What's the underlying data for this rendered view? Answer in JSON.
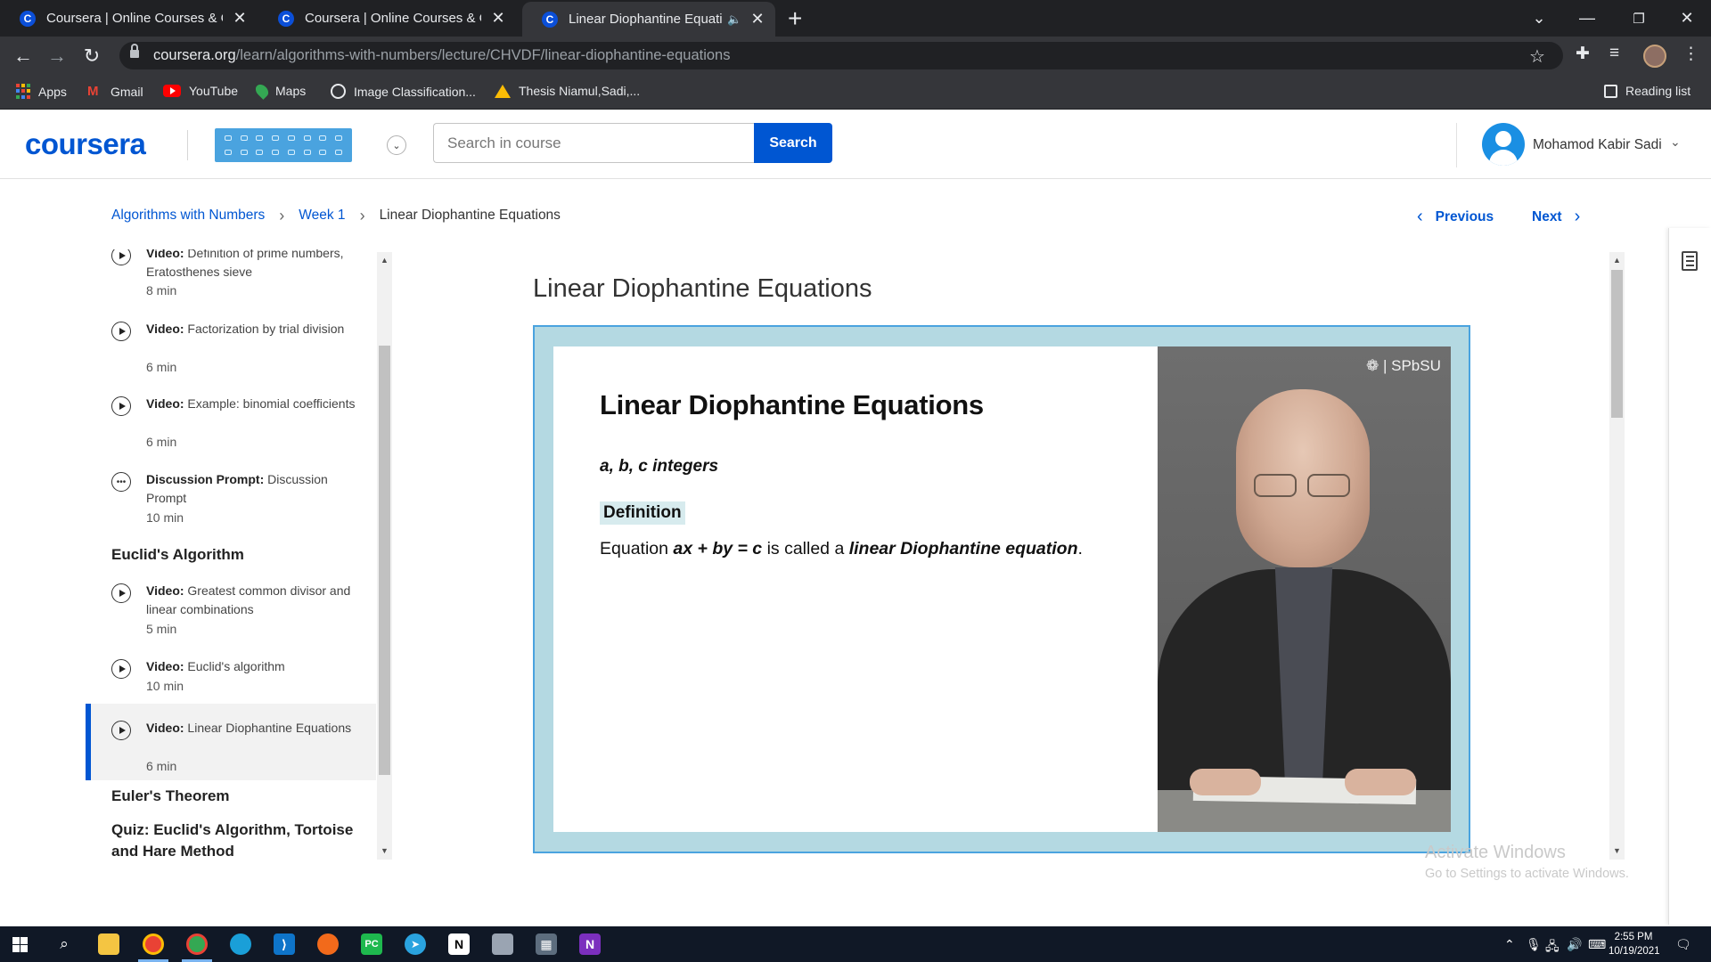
{
  "browser": {
    "tabs": [
      {
        "title": "Coursera | Online Courses & Credentials",
        "favicon": "C",
        "active": false
      },
      {
        "title": "Coursera | Online Courses & Credentials",
        "favicon": "C",
        "active": false
      },
      {
        "title": "Linear Diophantine Equations",
        "favicon": "C",
        "active": true,
        "audio": true
      }
    ],
    "url_host": "coursera.org",
    "url_path": "/learn/algorithms-with-numbers/lecture/CHVDF/linear-diophantine-equations",
    "bookmarks": [
      {
        "label": "Apps",
        "icon": "apps-grid-icon"
      },
      {
        "label": "Gmail",
        "icon": "gmail-icon"
      },
      {
        "label": "YouTube",
        "icon": "youtube-icon"
      },
      {
        "label": "Maps",
        "icon": "maps-pin-icon"
      },
      {
        "label": "Image Classification...",
        "icon": "globe-icon"
      },
      {
        "label": "Thesis Niamul,Sadi,...",
        "icon": "drive-icon"
      }
    ],
    "reading_list": "Reading list"
  },
  "header": {
    "logo": "coursera",
    "search_placeholder": "Search in course",
    "search_button": "Search",
    "user_name": "Mohamod Kabir Sadi"
  },
  "breadcrumb": {
    "course": "Algorithms with Numbers",
    "week": "Week 1",
    "current": "Linear Diophantine Equations"
  },
  "nav": {
    "previous": "Previous",
    "next": "Next"
  },
  "sidebar": {
    "items": [
      {
        "type": "Video:",
        "title": "Definition of prime numbers, Eratosthenes sieve",
        "duration": "8 min"
      },
      {
        "type": "Video:",
        "title": "Factorization by trial division",
        "duration": "6 min"
      },
      {
        "type": "Video:",
        "title": "Example: binomial coefficients",
        "duration": "6 min"
      },
      {
        "type": "Discussion Prompt:",
        "title": "Discussion Prompt",
        "duration": "10 min"
      },
      {
        "type": "Video:",
        "title": "Greatest common divisor and linear combinations",
        "duration": "5 min"
      },
      {
        "type": "Video:",
        "title": "Euclid's algorithm",
        "duration": "10 min"
      },
      {
        "type": "Video:",
        "title": "Linear Diophantine Equations",
        "duration": "6 min"
      }
    ],
    "headings": [
      "Euclid's Algorithm",
      "Euler's Theorem",
      "Quiz: Euclid's Algorithm, Tortoise and Hare Method"
    ]
  },
  "lecture": {
    "title": "Linear Diophantine Equations",
    "slide": {
      "title": "Linear Diophantine Equations",
      "subtitle": "a, b, c integers",
      "definition_label": "Definition",
      "eq_prefix": "Equation ",
      "eq_math": "ax + by = c",
      "eq_mid": " is called a ",
      "eq_term": "linear Diophantine equation",
      "eq_end": "."
    },
    "speaker_logo": "SPbSU"
  },
  "watermark": {
    "line1": "Activate Windows",
    "line2": "Go to Settings to activate Windows."
  },
  "taskbar": {
    "time": "2:55 PM",
    "date": "10/19/2021"
  },
  "colors": {
    "brand": "#0056d2",
    "chrome_dark": "#202124",
    "chrome_toolbar": "#35363a",
    "video_frame": "#b4d9e2",
    "taskbar": "#101826"
  }
}
